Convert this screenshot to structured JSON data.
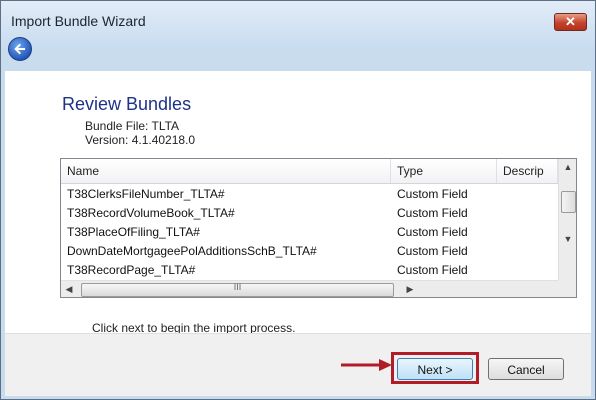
{
  "window": {
    "title": "Import Bundle Wizard",
    "close_glyph": "✕",
    "close_icon": "close-icon",
    "back_icon": "back-arrow-icon"
  },
  "review": {
    "heading": "Review Bundles",
    "bundle_file": "Bundle File: TLTA",
    "version": "Version: 4.1.40218.0"
  },
  "table": {
    "columns": [
      "Name",
      "Type",
      "Descrip"
    ],
    "rows": [
      {
        "name": "T38ClerksFileNumber_TLTA#",
        "type": "Custom Field"
      },
      {
        "name": "T38RecordVolumeBook_TLTA#",
        "type": "Custom Field"
      },
      {
        "name": "T38PlaceOfFiling_TLTA#",
        "type": "Custom Field"
      },
      {
        "name": "DownDateMortgageePolAdditionsSchB_TLTA#",
        "type": "Custom Field"
      },
      {
        "name": "T38RecordPage_TLTA#",
        "type": "Custom Field"
      }
    ],
    "scroll": {
      "up": "▲",
      "down": "▼",
      "left": "◀",
      "right": "▶",
      "grip": "III"
    }
  },
  "hint": "Click next to begin the import process.",
  "buttons": {
    "next": "Next >",
    "cancel": "Cancel"
  },
  "colors": {
    "heading": "#1e3287",
    "highlight": "#b01c27",
    "annotation_arrow": "#b01c27"
  }
}
